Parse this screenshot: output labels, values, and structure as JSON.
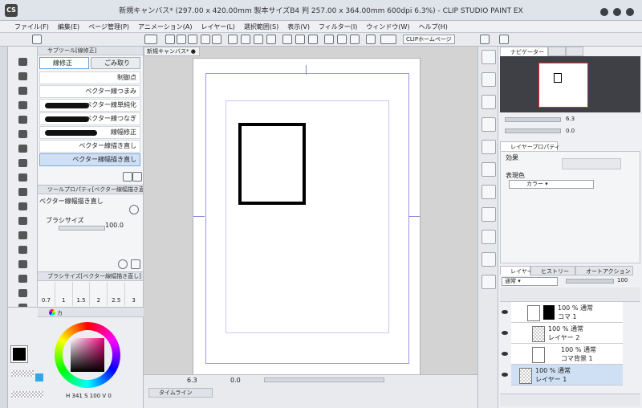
{
  "app": {
    "logo": "CS",
    "title": "新規キャンバス* (297.00 x 420.00mm 製本サイズB4 判 257.00 x 364.00mm 600dpi 6.3%) - CLIP STUDIO PAINT EX"
  },
  "menu": [
    "ファイル(F)",
    "編集(E)",
    "ページ管理(P)",
    "アニメーション(A)",
    "レイヤー(L)",
    "選択範囲(S)",
    "表示(V)",
    "フィルター(I)",
    "ウィンドウ(W)",
    "ヘルプ(H)"
  ],
  "cmdbar": {
    "home_label": "CLIPホームページ"
  },
  "subtool": {
    "header": "サブツール[線修正]",
    "tabs": [
      "線修正",
      "ごみ取り"
    ],
    "items": [
      "制御点",
      "ベクター線つまみ",
      "ベクター線単純化",
      "ベクター線つなぎ",
      "線幅修正",
      "ベクター線描き直し",
      "ベクター線幅描き直し"
    ]
  },
  "toolprop": {
    "header": "ツールプロパティ[ベクター線幅描き直し]",
    "name": "ベクター線幅描き直し",
    "brush_label": "ブラシサイズ",
    "brush_value": "100.0"
  },
  "brushsize": {
    "header": "ブラシサイズ[ベクター線幅描き直し]",
    "sizes": [
      "0.7",
      "1",
      "1.5",
      "2",
      "2.5",
      "3"
    ]
  },
  "color": {
    "tab": "カ",
    "main": "#000000",
    "sub": "#2ea8e8",
    "hue_r": "341",
    "value_v": "100",
    "g": "0"
  },
  "canvas": {
    "tab": "新規キャンバス*"
  },
  "statusbar": {
    "zoom": "6.3",
    "angle": "0.0",
    "timeline": "タイムライン"
  },
  "navigator": {
    "tab": "ナビゲーター",
    "zoom": "6.3",
    "angle": "0.0"
  },
  "layerprop": {
    "tab": "レイヤープロパティ",
    "effect_label": "効果",
    "expr_label": "表現色",
    "expr_value": "カラー"
  },
  "layers": {
    "tabs": [
      "レイヤー",
      "ヒストリー",
      "オートアクション"
    ],
    "blend": "通常",
    "opacity": "100",
    "items": [
      {
        "top": "100 % 通常",
        "name": "コマ 1"
      },
      {
        "top": "100 % 通常",
        "name": "レイヤー 2"
      },
      {
        "top": "100 % 通常",
        "name": "コマ背景 1"
      },
      {
        "top": "100 % 通常",
        "name": "レイヤー 1"
      }
    ]
  },
  "colors": {
    "accent": "#6f9fd6",
    "selection": "#cfe0f4",
    "panel": "#eef0f3"
  }
}
